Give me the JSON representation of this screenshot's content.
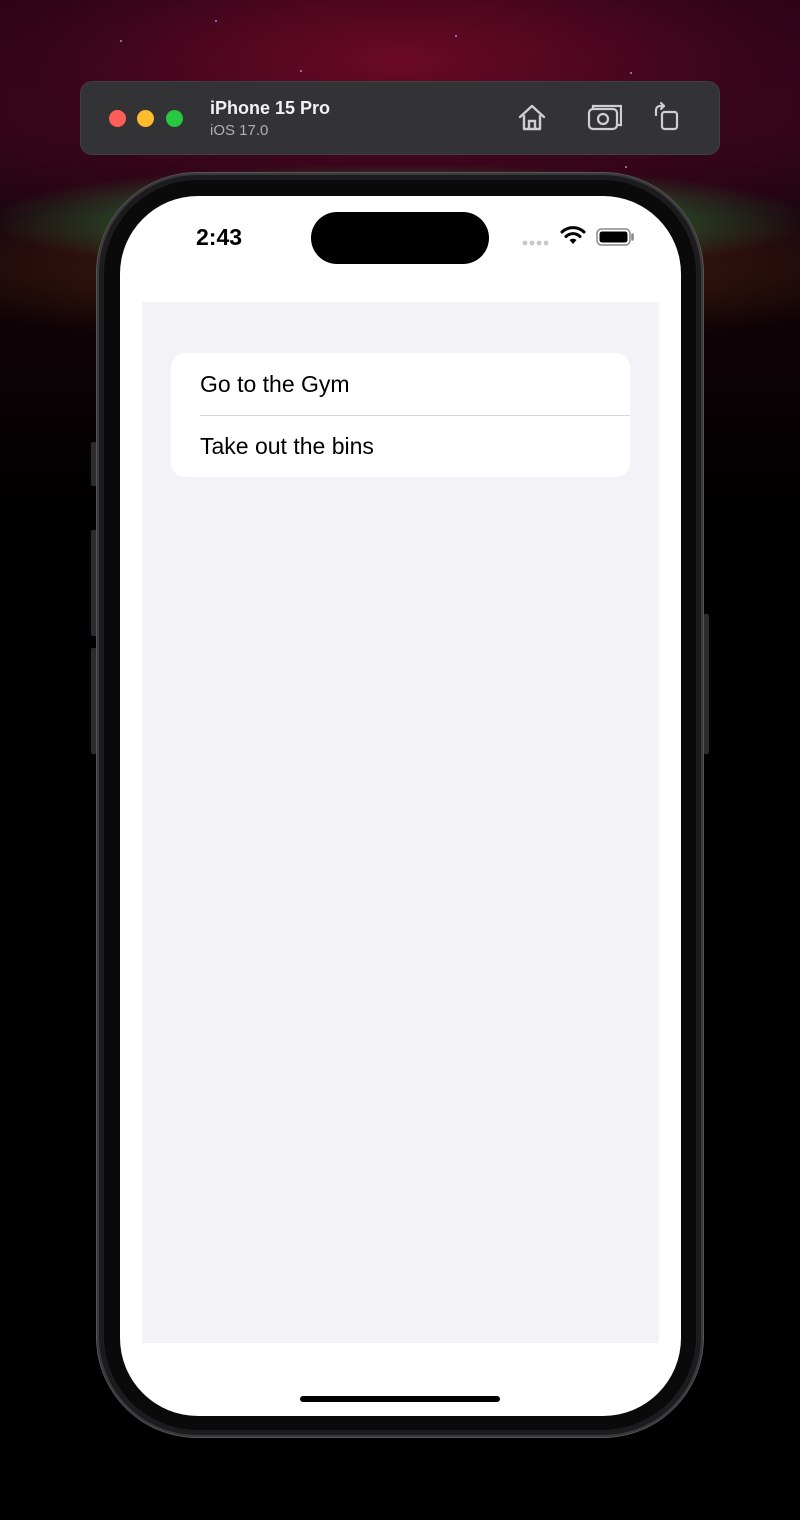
{
  "simulator": {
    "device_name": "iPhone 15 Pro",
    "os_version": "iOS 17.0",
    "toolbar_icons": [
      "home-icon",
      "screenshot-icon",
      "rotate-icon"
    ]
  },
  "status_bar": {
    "time": "2:43",
    "icons": [
      "cellular-signal-icon",
      "wifi-icon",
      "battery-icon"
    ]
  },
  "list": {
    "items": [
      {
        "label": "Go to the Gym"
      },
      {
        "label": "Take out the bins"
      }
    ]
  },
  "colors": {
    "close": "#ff5f57",
    "minimize": "#febc2e",
    "zoom": "#28c840",
    "grouped_background": "#f2f2f7"
  }
}
